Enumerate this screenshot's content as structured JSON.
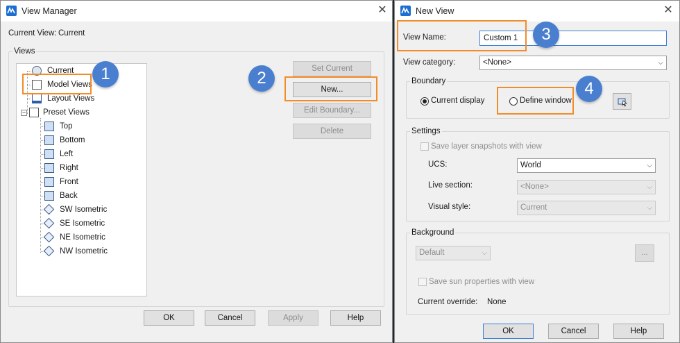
{
  "view_manager": {
    "title": "View Manager",
    "close_glyph": "✕",
    "current_view_label": "Current View:",
    "current_view_value": "Current",
    "views_group_label": "Views",
    "tree": {
      "current": "Current",
      "model_views": "Model Views",
      "layout_views": "Layout Views",
      "preset_views": "Preset Views",
      "presets": [
        "Top",
        "Bottom",
        "Left",
        "Right",
        "Front",
        "Back",
        "SW Isometric",
        "SE Isometric",
        "NE Isometric",
        "NW Isometric"
      ]
    },
    "buttons": {
      "set_current": "Set Current",
      "new": "New...",
      "edit_boundary": "Edit Boundary...",
      "delete": "Delete",
      "ok": "OK",
      "cancel": "Cancel",
      "apply": "Apply",
      "help": "Help"
    }
  },
  "new_view": {
    "title": "New View",
    "close_glyph": "✕",
    "view_name_label": "View Name:",
    "view_name_value": "Custom 1",
    "view_category_label": "View category:",
    "view_category_value": "<None>",
    "boundary_label": "Boundary",
    "current_display_label": "Current display",
    "define_window_label": "Define window",
    "settings_label": "Settings",
    "save_layer_snapshots_label": "Save layer snapshots with view",
    "ucs_label": "UCS:",
    "ucs_value": "World",
    "live_section_label": "Live section:",
    "live_section_value": "<None>",
    "visual_style_label": "Visual style:",
    "visual_style_value": "Current",
    "background_label": "Background",
    "background_value": "Default",
    "ellipsis_button": "...",
    "save_sun_label": "Save sun properties with view",
    "current_override_label": "Current override:",
    "current_override_value": "None",
    "buttons": {
      "ok": "OK",
      "cancel": "Cancel",
      "help": "Help"
    }
  },
  "callouts": [
    "1",
    "2",
    "3",
    "4"
  ],
  "colors": {
    "highlight": "#f28c28",
    "callout": "#4a7fd0",
    "app_icon": "#1c6fd0"
  }
}
